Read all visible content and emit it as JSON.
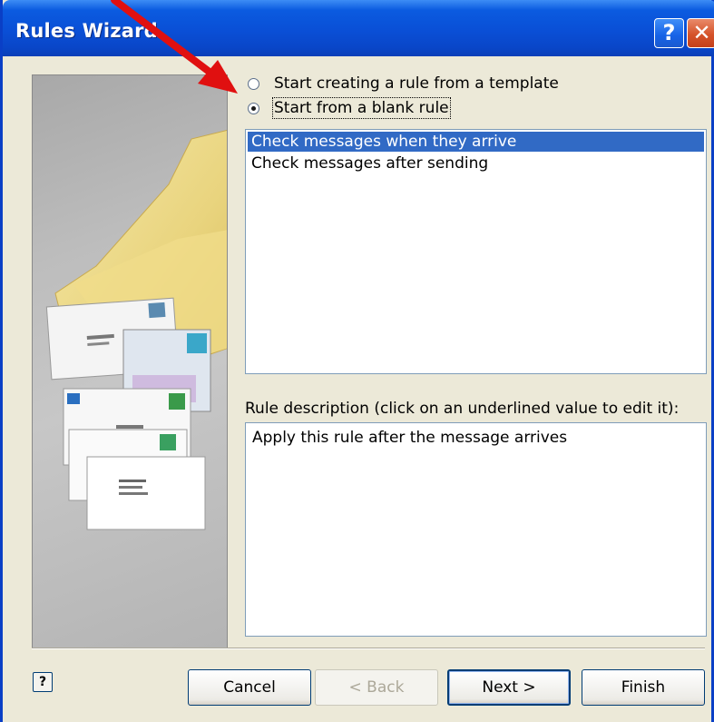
{
  "window": {
    "title": "Rules Wizard",
    "help_glyph": "?",
    "close_glyph": "✕"
  },
  "options": {
    "template": {
      "label": "Start creating a rule from a template",
      "checked": false
    },
    "blank": {
      "label": "Start from a blank rule",
      "checked": true
    }
  },
  "rule_list": {
    "items": [
      {
        "label": "Check messages when they arrive",
        "selected": true
      },
      {
        "label": "Check messages after sending",
        "selected": false
      }
    ]
  },
  "description": {
    "label": "Rule description (click on an underlined value to edit it):",
    "text": "Apply this rule after the message arrives"
  },
  "buttons": {
    "help_glyph": "?",
    "cancel": "Cancel",
    "back": "< Back",
    "next": "Next >",
    "finish": "Finish"
  },
  "colors": {
    "titlebar": "#0a4fd6",
    "selection": "#316ac5",
    "annotation_arrow": "#e01010"
  }
}
